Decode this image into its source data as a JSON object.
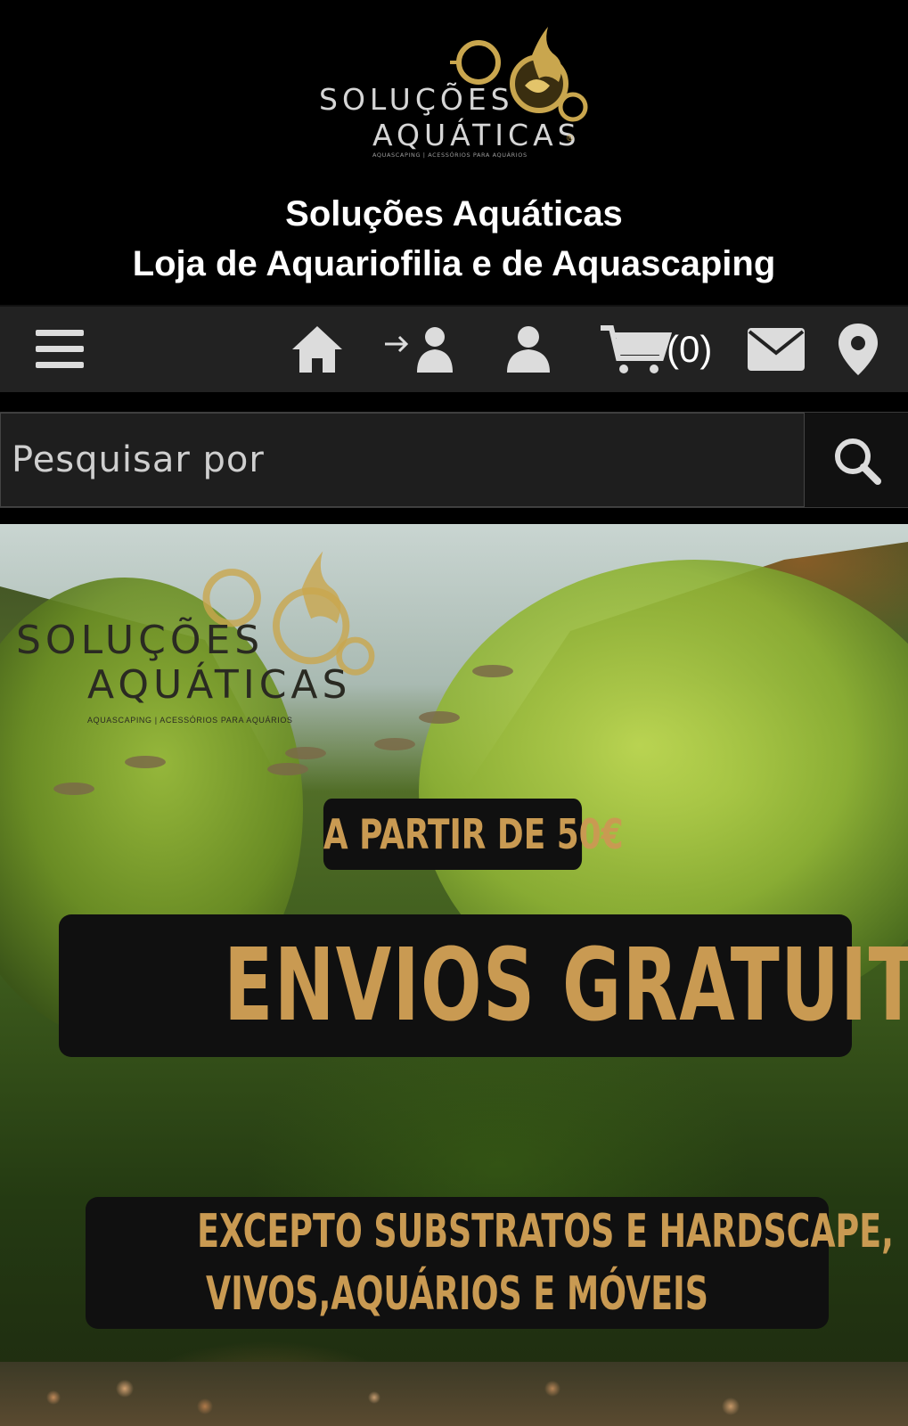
{
  "header": {
    "logo": {
      "line1": "SOLUÇÕES",
      "line2": "AQUÁTICAS",
      "tagline": "AQUASCAPING | ACESSÓRIOS PARA AQUÁRIOS",
      "brand_color": "#c9a64e"
    },
    "title_line1": "Soluções Aquáticas",
    "title_line2": "Loja de Aquariofilia e de Aquascaping"
  },
  "nav": {
    "icons": [
      "menu-icon",
      "home-icon",
      "login-icon",
      "account-icon",
      "cart-icon",
      "mail-icon",
      "location-pin-icon"
    ],
    "cart_count": "(0)",
    "icon_color": "#dcdcdc"
  },
  "search": {
    "placeholder": "Pesquisar por",
    "value": ""
  },
  "banner": {
    "logo": {
      "line1": "SOLUÇÕES",
      "line2": "AQUÁTICAS",
      "tagline": "AQUASCAPING | ACESSÓRIOS PARA AQUÁRIOS"
    },
    "promo_threshold": "A PARTIR DE 50€",
    "promo_headline": "ENVIOS GRATUITOS*",
    "promo_note_line1": "EXCEPTO SUBSTRATOS E HARDSCAPE,",
    "promo_note_line2": "VIVOS,AQUÁRIOS E MÓVEIS",
    "accent_color": "#c99a52"
  }
}
